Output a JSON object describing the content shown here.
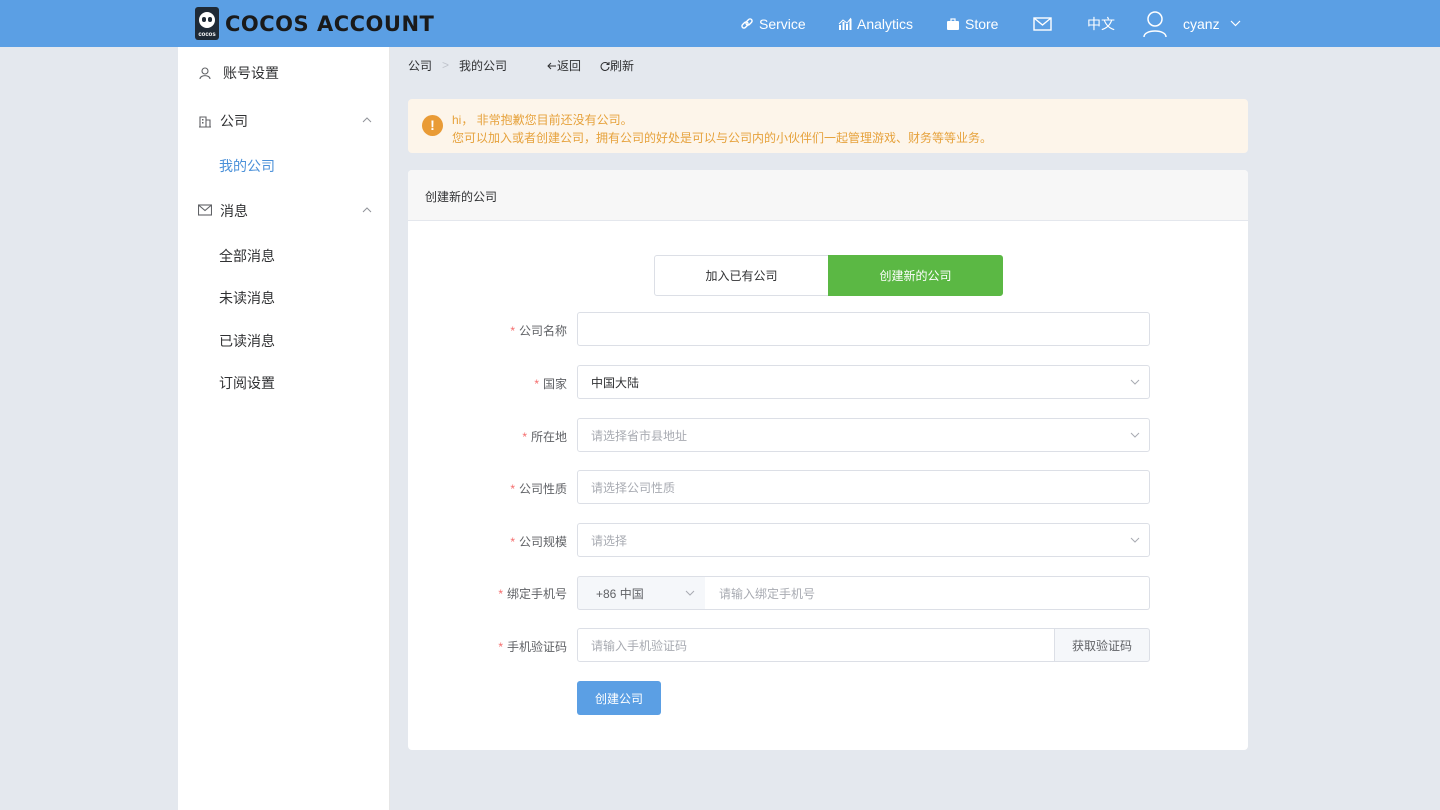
{
  "header": {
    "logo_text": "COCOS ACCOUNT",
    "logo_mark_text": "cocos",
    "nav": [
      {
        "label": "Service",
        "icon": "link-icon"
      },
      {
        "label": "Analytics",
        "icon": "bar-chart-icon"
      },
      {
        "label": "Store",
        "icon": "briefcase-icon"
      }
    ],
    "mail_icon": "mail-icon",
    "language": "中文",
    "username": "cyanz"
  },
  "sidebar": {
    "account_settings": "账号设置",
    "company": "公司",
    "my_company": "我的公司",
    "messages": "消息",
    "all_messages": "全部消息",
    "unread_messages": "未读消息",
    "read_messages": "已读消息",
    "subscription_settings": "订阅设置"
  },
  "breadcrumb": {
    "root": "公司",
    "current": "我的公司",
    "back": "返回",
    "refresh": "刷新"
  },
  "alert": {
    "icon": "!",
    "line1": "hi， 非常抱歉您目前还没有公司。",
    "line2": "您可以加入或者创建公司，拥有公司的好处是可以与公司内的小伙伴们一起管理游戏、财务等等业务。"
  },
  "card": {
    "title": "创建新的公司",
    "tab_join": "加入已有公司",
    "tab_create": "创建新的公司",
    "fields": {
      "company_name": {
        "label": "公司名称",
        "value": ""
      },
      "country": {
        "label": "国家",
        "value": "中国大陆"
      },
      "location": {
        "label": "所在地",
        "placeholder": "请选择省市县地址"
      },
      "nature": {
        "label": "公司性质",
        "placeholder": "请选择公司性质"
      },
      "scale": {
        "label": "公司规模",
        "placeholder": "请选择"
      },
      "phone": {
        "label": "绑定手机号",
        "prefix": "+86 中国",
        "placeholder": "请输入绑定手机号"
      },
      "code": {
        "label": "手机验证码",
        "placeholder": "请输入手机验证码",
        "button": "获取验证码"
      }
    },
    "required_mark": "*",
    "submit": "创建公司"
  },
  "colors": {
    "header_bg": "#5b9fe4",
    "active_tab": "#5bb844",
    "link_active": "#4a90d9",
    "alert_bg": "#fdf5ea",
    "alert_text": "#e6a23c",
    "required": "#f56c6c"
  }
}
